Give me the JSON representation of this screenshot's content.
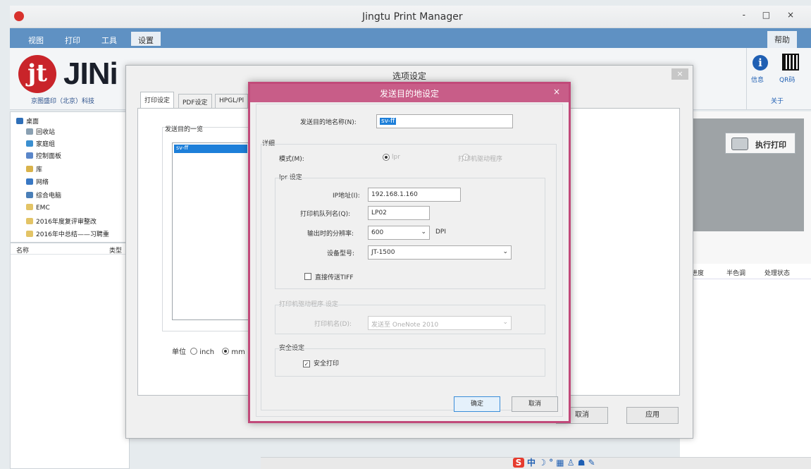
{
  "app": {
    "title": "Jingtu Print Manager",
    "win_controls": "- □ ×"
  },
  "menu": {
    "items": [
      "视图",
      "打印",
      "工具",
      "设置"
    ],
    "help_tab": "帮助"
  },
  "ribbon": {
    "logo_badge": "jt",
    "logo_text": "JINi",
    "company": "京图盛印（北京）科技",
    "info_label": "信息",
    "qr_label": "QR码",
    "about_label": "关于"
  },
  "tree": {
    "items": [
      "桌面",
      "回收站",
      "家庭组",
      "控制面板",
      "库",
      "网络",
      "综合电脑",
      "EMC",
      "2016年度复评审整改",
      "2016年中总结——习聘重"
    ]
  },
  "filelist": {
    "col_name": "名称",
    "col_type": "类型"
  },
  "right": {
    "exec_label": "执行打印",
    "col_1": "进度",
    "col_2": "半色调",
    "col_3": "处理状态"
  },
  "ime": {
    "text": "中 ☽ ° ▦ ♙ ☗ ✎",
    "badge": "S"
  },
  "options_dialog": {
    "title": "选项设定",
    "close": "×",
    "tabs": [
      "打印设定",
      "PDF设定",
      "HPGL/Pl"
    ],
    "dest_list_label": "发送目的一览",
    "dest_item": "sv-ff",
    "unit_label": "单位",
    "unit_inch": "inch",
    "unit_mm": "mm",
    "btn_cancel": "取消",
    "btn_apply": "应用"
  },
  "dest_dialog": {
    "title": "发送目的地设定",
    "close": "×",
    "name_label": "发送目的地名称(N):",
    "name_value": "sv-ff",
    "detail_label": "详细",
    "mode_label": "模式(M):",
    "mode_lpr": "lpr",
    "mode_driver": "打印机驱动程序",
    "lpr_group": "lpr 设定",
    "ip_label": "IP地址(I):",
    "ip_value": "192.168.1.160",
    "queue_label": "打印机队列名(Q):",
    "queue_value": "LP02",
    "res_label": "输出时的分辨率:",
    "res_value": "600",
    "res_unit": "DPI",
    "model_label": "设备型号:",
    "model_value": "JT-1500",
    "direct_tiff": "直接传送TIFF",
    "driver_group": "打印机驱动程序 设定",
    "printer_label": "打印机名(D):",
    "printer_value": "发送至 OneNote 2010",
    "security_group": "安全设定",
    "secure_print": "安全打印",
    "ok": "确定",
    "cancel": "取消"
  }
}
